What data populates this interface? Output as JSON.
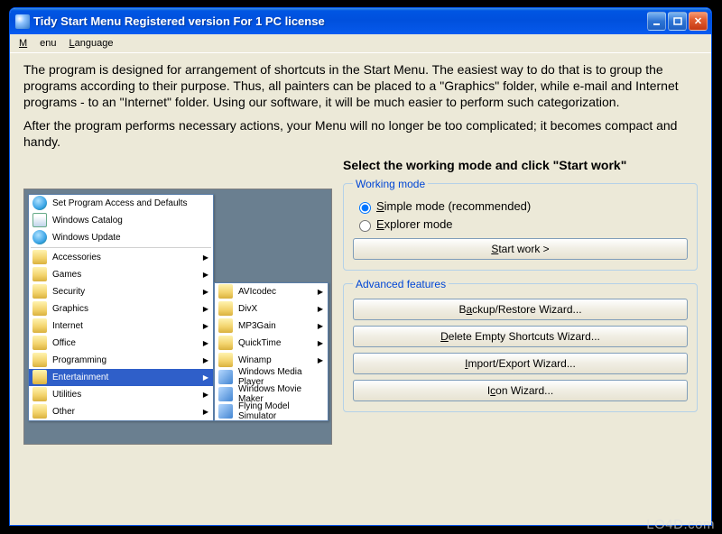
{
  "window_title": "Tidy Start Menu Registered version  For 1 PC license",
  "menubar": {
    "menu": "Menu",
    "language": "Language"
  },
  "description": "The program is designed for arrangement of shortcuts in the Start Menu. The easiest way to do that is to group the programs according to their purpose. Thus, all painters can be placed to a \"Graphics\" folder, while e-mail and Internet programs - to an \"Internet\" folder. Using our software, it will be much easier to perform such categorization.",
  "description2": "After the program performs necessary actions, your Menu will no longer be too complicated; it becomes compact and handy.",
  "select_head": "Select the working mode and click \"Start work\"",
  "working_mode": {
    "legend": "Working mode",
    "simple": "Simple mode (recommended)",
    "explorer": "Explorer mode",
    "start_work": "Start work >"
  },
  "advanced": {
    "legend": "Advanced features",
    "backup": "Backup/Restore Wizard...",
    "delete_empty": "Delete Empty Shortcuts Wizard...",
    "import_export": "Import/Export Wizard...",
    "icon_wiz": "Icon Wizard..."
  },
  "preview_menu": {
    "left": [
      {
        "label": "Set Program Access and Defaults",
        "icon": "globe"
      },
      {
        "label": "Windows Catalog",
        "icon": "book"
      },
      {
        "label": "Windows Update",
        "icon": "globe"
      },
      {
        "sep": true
      },
      {
        "label": "Accessories",
        "icon": "folder",
        "arrow": true
      },
      {
        "label": "Games",
        "icon": "folder",
        "arrow": true
      },
      {
        "label": "Security",
        "icon": "folder",
        "arrow": true
      },
      {
        "label": "Graphics",
        "icon": "folder",
        "arrow": true
      },
      {
        "label": "Internet",
        "icon": "folder",
        "arrow": true
      },
      {
        "label": "Office",
        "icon": "folder",
        "arrow": true
      },
      {
        "label": "Programming",
        "icon": "folder",
        "arrow": true
      },
      {
        "label": "Entertainment",
        "icon": "folder",
        "arrow": true,
        "selected": true
      },
      {
        "label": "Utilities",
        "icon": "folder",
        "arrow": true
      },
      {
        "label": "Other",
        "icon": "folder",
        "arrow": true
      }
    ],
    "right": [
      {
        "label": "AVIcodec",
        "icon": "folder",
        "arrow": true
      },
      {
        "label": "DivX",
        "icon": "folder",
        "arrow": true
      },
      {
        "label": "MP3Gain",
        "icon": "folder",
        "arrow": true
      },
      {
        "label": "QuickTime",
        "icon": "folder",
        "arrow": true
      },
      {
        "label": "Winamp",
        "icon": "folder",
        "arrow": true
      },
      {
        "label": "Windows Media Player",
        "icon": "app"
      },
      {
        "label": "Windows Movie Maker",
        "icon": "app"
      },
      {
        "label": "Flying Model Simulator",
        "icon": "app"
      }
    ]
  },
  "watermark": "LO4D.com"
}
